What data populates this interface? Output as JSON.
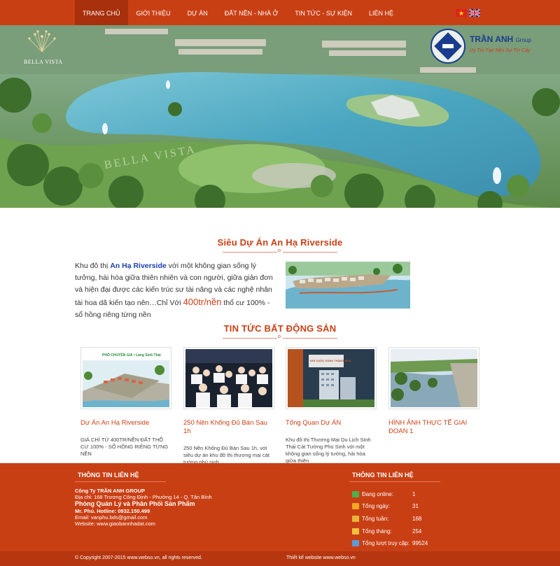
{
  "nav": {
    "items": [
      {
        "label": "TRANG CHỦ",
        "active": true
      },
      {
        "label": "GIỚI THIỆU",
        "active": false
      },
      {
        "label": "DỰ ÁN",
        "active": false
      },
      {
        "label": "ĐẤT NỀN - NHÀ Ở",
        "active": false
      },
      {
        "label": "TIN TỨC - SỰ KIỆN",
        "active": false
      },
      {
        "label": "LIÊN HỆ",
        "active": false
      }
    ],
    "flags": [
      "vietnam-flag-icon",
      "uk-flag-icon"
    ]
  },
  "banner": {
    "project_logo_text": "BELLA VISTA",
    "company_name": "TRẦN ANH",
    "company_suffix": "Group",
    "company_slogan": "Uy Tín Tạo Nên Sự Tin Cậy"
  },
  "intro": {
    "title": "Siêu Dự Án An Hạ Riverside",
    "text_before_link": "Khu đô thị ",
    "link_text": "An Hạ Riverside",
    "text_after_link": " với một không gian sống lý tưởng, hài hòa giữa thiên nhiên và con người, giữa giản đơn và hiện đại được các kiến trúc sư tài năng và các nghệ nhân tài hoa dã kiến tạo nên…Chỉ Với ",
    "price_text": "400tr/nền",
    "text_after_price": "  thổ cư 100% - sổ hồng riêng từng nền"
  },
  "news": {
    "title": "TIN TỨC BẤT ĐỘNG SẢN",
    "items": [
      {
        "title": "Dự Án An Hạ Riverside",
        "desc": "GIÁ CHỈ TỪ 400TR/NỀN ĐẤT THỔ CƯ 100% - SỔ HỒNG RIÊNG TỪNG NỀN",
        "image_caption": "PHỐ CHUYÊN GIA • Làng Sinh Thái"
      },
      {
        "title": "250 Nền Khổng Đủ Bán Sau 1h",
        "desc": "250 Nền Khổng Đủ Bán Sau 1h, với siêu dự án khu đô thị thương mại cát tường phú sinh"
      },
      {
        "title": "Tổng Quan Dự ÁN",
        "desc": "Khu đô thị Thương Mại Du Lịch Sinh Thái Cát Tường Phú Sinh với một không gian sống lý tưởng, hài hòa giữa thiên",
        "image_caption": "NƠI CUỘC SỐNG THĂNG HOA"
      },
      {
        "title": "HÌNH ẢNH THỰC TẾ GIAI ĐOẠN 1",
        "desc": ""
      }
    ]
  },
  "footer": {
    "contact_heading": "THÔNG TIN LIÊN HỆ",
    "company": "Công Ty TRẦN ANH GROUP",
    "address": "Địa chỉ: 168 Trương Công Định - Phường 14 - Q. Tân Bình",
    "department": "Phòng Quản Lý và Phân Phối Sản Phẩm",
    "hotline": "Mr. Phú. Hotline: 0932.150.499",
    "email": "Email: vanphu.bds@gmail.com",
    "website": "Website: www.giaobannhadat.com",
    "stats_heading": "THÔNG TIN LIÊN HỆ",
    "stats": [
      {
        "label": "Đang online:",
        "value": "1",
        "icon": "online-users-icon",
        "color": "#4caf50"
      },
      {
        "label": "Tổng ngày:",
        "value": "31",
        "icon": "calendar-day-icon",
        "color": "#f5a623"
      },
      {
        "label": "Tổng tuần:",
        "value": "168",
        "icon": "calendar-week-icon",
        "color": "#e8b43a"
      },
      {
        "label": "Tổng tháng:",
        "value": "254",
        "icon": "calendar-month-icon",
        "color": "#f0c040"
      },
      {
        "label": "Tổng lượt truy cập:",
        "value": "99524",
        "icon": "visits-chart-icon",
        "color": "#5b9bd5"
      }
    ],
    "copyright": "© Copyright 2007-2015 www.webso.vn, all rights reserved.",
    "design_credit": "Thiết kế website www.webso.vn"
  },
  "colors": {
    "brand": "#c93f14",
    "brand_dark": "#a8300c",
    "link": "#1a3fb0"
  }
}
